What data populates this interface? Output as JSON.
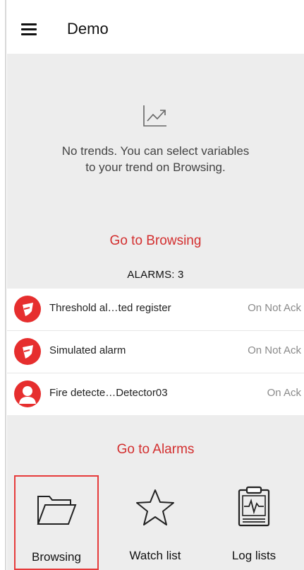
{
  "header": {
    "title": "Demo",
    "menu_icon": "hamburger-menu-icon"
  },
  "trends": {
    "icon": "trend-chart-icon",
    "empty_line1": "No trends. You can select variables",
    "empty_line2": "to your trend on Browsing.",
    "go_to_browsing": "Go to Browsing"
  },
  "alarms": {
    "title": "ALARMS: 3",
    "items": [
      {
        "name": "Threshold al…ted register",
        "status": "On Not Ack",
        "icon": "alarm-shield-icon"
      },
      {
        "name": "Simulated alarm",
        "status": "On Not Ack",
        "icon": "alarm-shield-icon"
      },
      {
        "name": "Fire detecte…Detector03",
        "status": "On Ack",
        "icon": "person-icon"
      }
    ],
    "go_to_alarms": "Go to Alarms"
  },
  "tiles": [
    {
      "label": "Browsing",
      "icon": "folder-icon",
      "selected": true
    },
    {
      "label": "Watch list",
      "icon": "star-icon",
      "selected": false
    },
    {
      "label": "Log lists",
      "icon": "clipboard-pulse-icon",
      "selected": false
    }
  ],
  "colors": {
    "accent": "#d32f2f",
    "alarm_icon": "#e62e2e",
    "content_bg": "#ededed"
  }
}
